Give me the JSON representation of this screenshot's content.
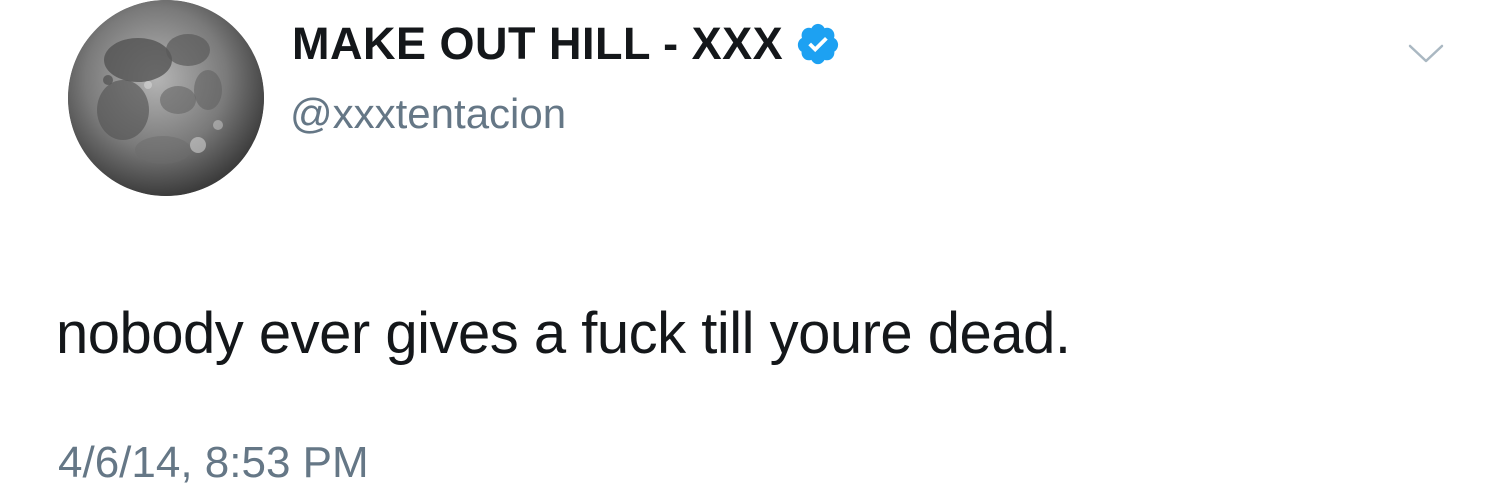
{
  "tweet": {
    "author": {
      "display_name": "MAKE OUT HILL - XXX",
      "handle": "@xxxtentacion",
      "verified": true,
      "avatar": "moon-avatar"
    },
    "text": "nobody ever gives a fuck till youre dead.",
    "timestamp": "4/6/14, 8:53 PM",
    "menu_icon": "chevron-down-icon"
  },
  "colors": {
    "text": "#14171a",
    "secondary": "#657786",
    "verified_badge": "#1da1f2",
    "background": "#ffffff"
  }
}
